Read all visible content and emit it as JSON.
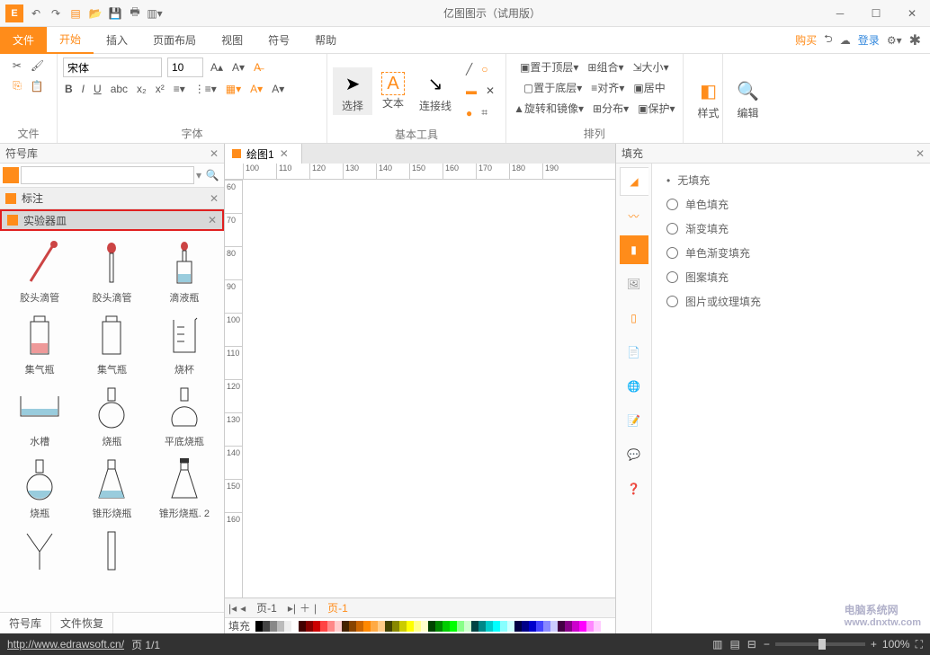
{
  "window_title": "亿图图示（试用版）",
  "quick_access": [
    "undo",
    "redo",
    "new",
    "open",
    "save",
    "print",
    "export"
  ],
  "menu": {
    "file": "文件",
    "tabs": [
      "开始",
      "插入",
      "页面布局",
      "视图",
      "符号",
      "帮助"
    ],
    "active": "开始",
    "right": {
      "buy": "购买",
      "login": "登录"
    }
  },
  "ribbon": {
    "file_group": "文件",
    "font_group": "字体",
    "font_name": "宋体",
    "font_size": "10",
    "tools_group": "基本工具",
    "select": "选择",
    "text": "文本",
    "connector": "连接线",
    "arrange_group": "排列",
    "bring_front": "置于顶层",
    "send_back": "置于底层",
    "rotate": "旋转和镜像",
    "group": "组合",
    "align": "对齐",
    "distribute": "分布",
    "size": "大小",
    "center": "居中",
    "protect": "保护",
    "style_group": "样式",
    "edit_group": "编辑"
  },
  "symbol_panel": {
    "title": "符号库",
    "search_placeholder": "",
    "libs": [
      {
        "name": "标注",
        "selected": false
      },
      {
        "name": "实验器皿",
        "selected": true
      }
    ],
    "shapes": [
      "胶头滴管",
      "胶头滴管",
      "滴液瓶",
      "集气瓶",
      "集气瓶",
      "烧杯",
      "水槽",
      "烧瓶",
      "平底烧瓶",
      "烧瓶",
      "锥形烧瓶",
      "锥形烧瓶. 2"
    ],
    "bottom_tabs": [
      "符号库",
      "文件恢复"
    ]
  },
  "doc": {
    "tab": "绘图1",
    "page_label": "页-1",
    "page_active": "页-1"
  },
  "color_label": "填充",
  "fill_panel": {
    "title": "填充",
    "options": [
      "无填充",
      "单色填充",
      "渐变填充",
      "单色渐变填充",
      "图案填充",
      "图片或纹理填充"
    ]
  },
  "status": {
    "url": "http://www.edrawsoft.cn/",
    "page": "页 1/1",
    "zoom": "100%"
  },
  "watermark": "电脑系统网",
  "watermark_sub": "www.dnxtw.com",
  "ruler_h": [
    100,
    110,
    120,
    130,
    140,
    150,
    160,
    170,
    180,
    190
  ],
  "ruler_v": [
    60,
    70,
    80,
    90,
    100,
    110,
    120,
    130,
    140,
    150,
    160
  ]
}
